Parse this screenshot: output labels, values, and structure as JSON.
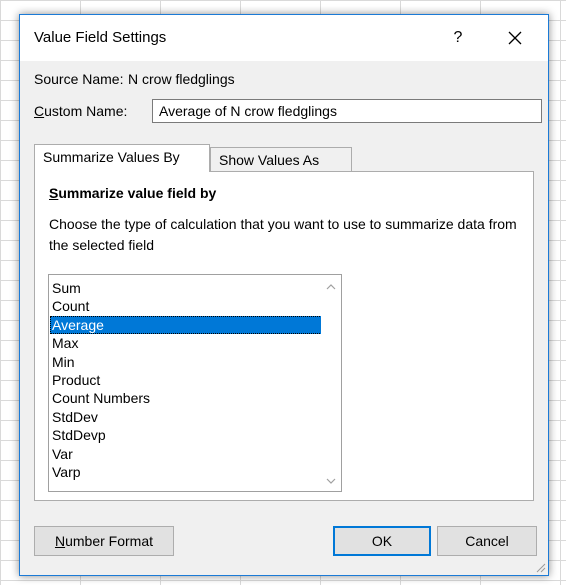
{
  "dialog": {
    "title": "Value Field Settings",
    "help_label": "?",
    "close_icon": "close-icon"
  },
  "source": {
    "label": "Source Name:",
    "value": "N crow fledglings"
  },
  "custom_name": {
    "label_mnemonic": "C",
    "label_rest": "ustom Name:",
    "value": "Average of N crow fledglings"
  },
  "tabs": [
    {
      "label": "Summarize Values By",
      "active": true
    },
    {
      "label": "Show Values As",
      "active": false
    }
  ],
  "summarize": {
    "group_mnemonic": "S",
    "group_rest": "ummarize value field by",
    "description": "Choose the type of calculation that you want to use to summarize data from the selected field",
    "items": [
      "Sum",
      "Count",
      "Average",
      "Max",
      "Min",
      "Product",
      "Count Numbers",
      "StdDev",
      "StdDevp",
      "Var",
      "Varp"
    ],
    "selected": "Average"
  },
  "buttons": {
    "number_format_mnemonic": "N",
    "number_format_rest": "umber Format",
    "ok": "OK",
    "cancel": "Cancel"
  },
  "colors": {
    "accent": "#0078d7",
    "dialog_bg": "#f0f0f0"
  }
}
